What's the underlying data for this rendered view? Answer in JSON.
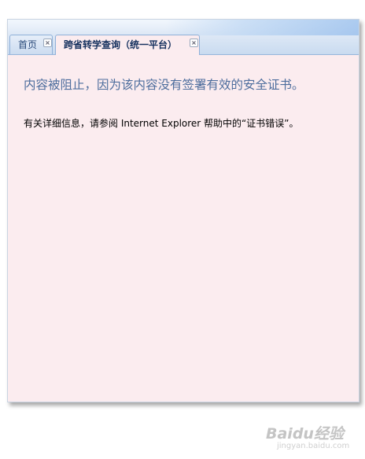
{
  "tabs": [
    {
      "label": "首页",
      "close": "×"
    },
    {
      "label": "跨省转学查询（统一平台）",
      "close": "×"
    }
  ],
  "message": {
    "title": "内容被阻止，因为该内容没有签署有效的安全证书。",
    "detail": "有关详细信息，请参阅 Internet Explorer 帮助中的“证书错误”。"
  },
  "watermark": {
    "brand": "Baidu经验",
    "url": "jingyan.baidu.com"
  },
  "colors": {
    "content_bg": "#fbecef",
    "title_text": "#4d6d9d",
    "tab_border": "#8fb0d8"
  }
}
